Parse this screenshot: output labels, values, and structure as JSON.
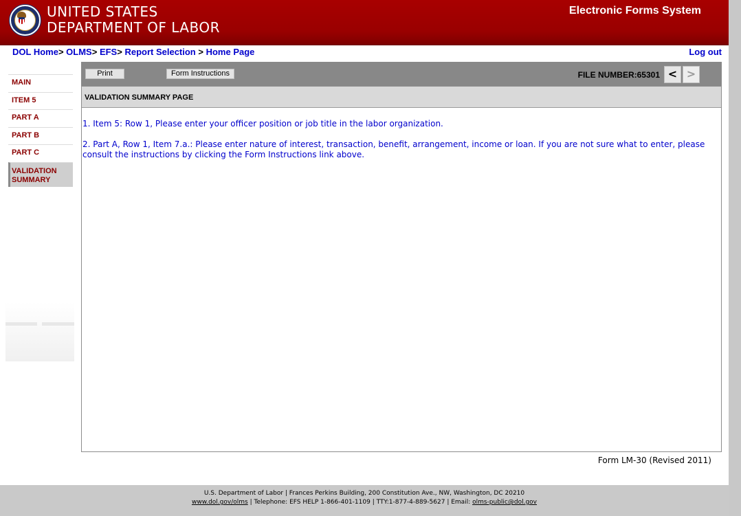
{
  "header": {
    "org_line1": "UNITED STATES",
    "org_line2": "DEPARTMENT OF LABOR",
    "system_title": "Electronic Forms System"
  },
  "breadcrumb": {
    "dol_home": "DOL Home",
    "sep1": ">",
    "olms": "OLMS",
    "sep2": ">",
    "efs": "EFS",
    "sep3": ">",
    "report_selection": "Report Selection",
    "sep4": ">",
    "home_page": "Home Page"
  },
  "logout_label": "Log out",
  "sidebar": {
    "items": [
      {
        "label": "MAIN"
      },
      {
        "label": "ITEM 5"
      },
      {
        "label": "PART A"
      },
      {
        "label": "PART B"
      },
      {
        "label": "PART C"
      },
      {
        "label": "VALIDATION SUMMARY",
        "active": true
      }
    ]
  },
  "toolbar": {
    "print_label": "Print",
    "instructions_label": "Form Instructions",
    "file_number": "FILE NUMBER:65301",
    "prev_label": "<",
    "next_label": ">"
  },
  "content": {
    "section_title": "VALIDATION SUMMARY PAGE",
    "messages": [
      "1. Item 5: Row 1, Please enter your officer position or job title in the labor organization.",
      "2. Part A, Row 1, Item 7.a.: Please enter nature of interest, transaction, benefit, arrangement, income or loan. If you are not sure what to enter, please consult the instructions by clicking the Form Instructions link above."
    ],
    "form_version": "Form LM-30 (Revised 2011)"
  },
  "footer": {
    "line1": "U.S. Department of Labor | Frances Perkins Building, 200 Constitution Ave., NW, Washington, DC 20210",
    "olms_link": "www.dol.gov/olms",
    "telephone_text": " | Telephone: EFS HELP 1-866-401-1109 | TTY:1-877-4-889-5627 | Email: ",
    "email_link": "olms-public@dol.gov"
  },
  "colors": {
    "header_red": "#a80000",
    "link_blue": "#0000cc",
    "sidebar_red": "#8b0000",
    "toolbar_gray": "#888888"
  }
}
